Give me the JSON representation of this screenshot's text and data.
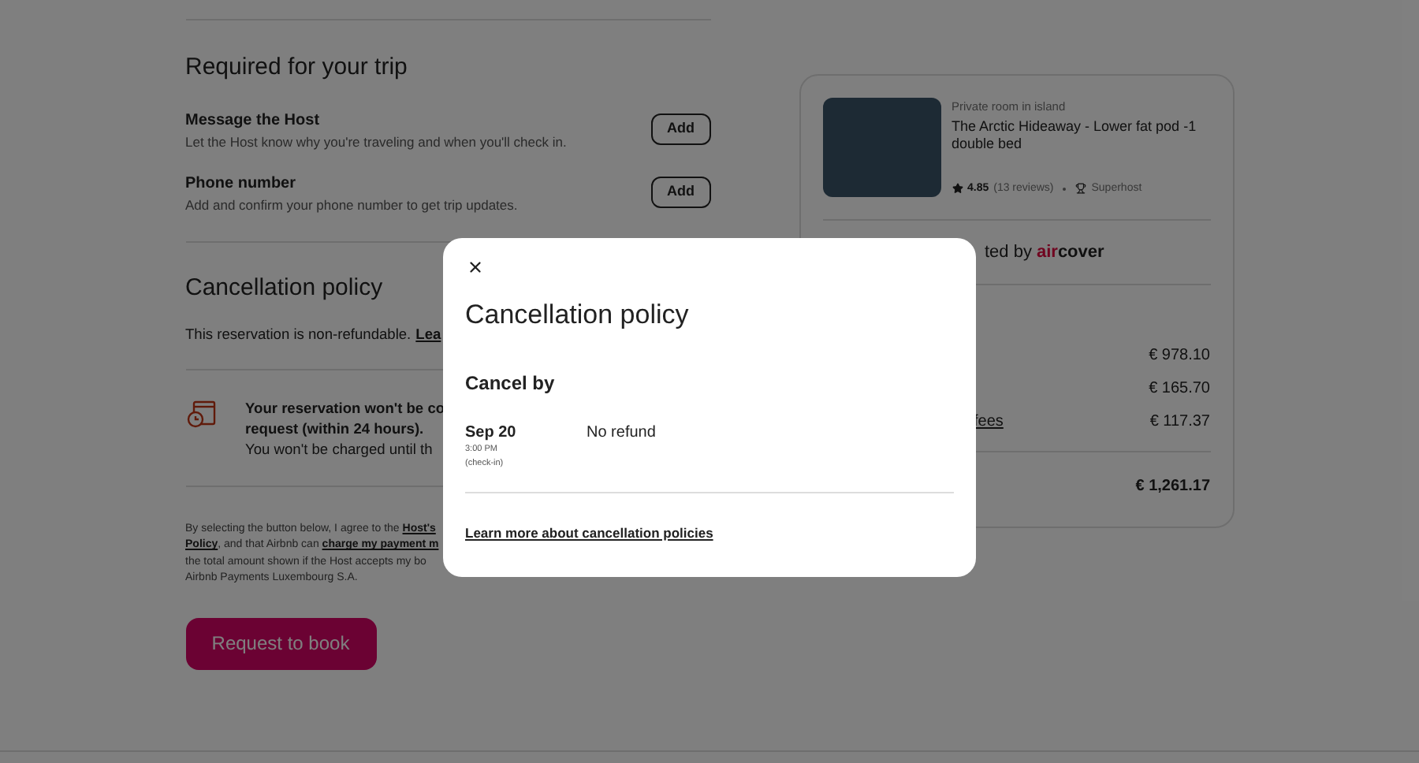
{
  "required": {
    "title": "Required for your trip",
    "items": [
      {
        "title": "Message the Host",
        "description": "Let the Host know why you're traveling and when you'll check in.",
        "button": "Add"
      },
      {
        "title": "Phone number",
        "description": "Add and confirm your phone number to get trip updates.",
        "button": "Add"
      }
    ]
  },
  "cancellation": {
    "title": "Cancellation policy",
    "text": "This reservation is non-refundable.",
    "link": "Lea"
  },
  "notice": {
    "lines": [
      "Your reservation won't be co",
      "request (within 24 hours).",
      "You won't be charged until th"
    ]
  },
  "terms": {
    "lines": [
      [
        {
          "kind": "text",
          "text": "By selecting the button below, I agree to the "
        },
        {
          "kind": "link",
          "text": "Host's"
        }
      ],
      [
        {
          "kind": "link",
          "text": "Policy"
        },
        {
          "kind": "text",
          "text": ", and that Airbnb can "
        },
        {
          "kind": "link",
          "text": "charge my payment m"
        }
      ],
      [
        {
          "kind": "text",
          "text": "the total amount shown if the Host accepts my bo"
        }
      ],
      [
        {
          "kind": "text",
          "text": "Airbnb Payments Luxembourg S.A."
        }
      ]
    ]
  },
  "book_button": "Request to book",
  "listing": {
    "type": "Private room in island",
    "title": "The Arctic Hideaway - Lower fat pod -1 double bed",
    "rating": "4.85",
    "reviews": "(13 reviews)",
    "badge": "Superhost"
  },
  "protection": {
    "text": "ted by",
    "brand_prefix": "air",
    "brand_suffix": "cover"
  },
  "prices": [
    {
      "amount": "€ 978.10"
    },
    {
      "amount": "€ 165.70"
    },
    {
      "label": "fees",
      "amount": "€ 117.37"
    }
  ],
  "total": "€ 1,261.17",
  "modal": {
    "title": "Cancellation policy",
    "subtitle": "Cancel by",
    "rows": [
      {
        "date": "Sep 20",
        "time": "3:00 PM",
        "note": "(check-in)",
        "refund": "No refund"
      }
    ],
    "link": "Learn more about cancellation policies"
  }
}
